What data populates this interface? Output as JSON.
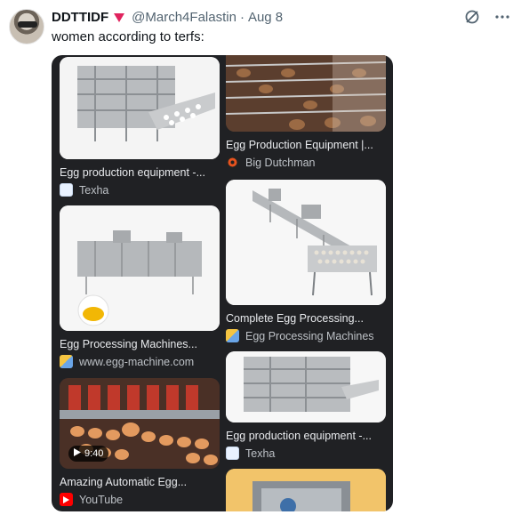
{
  "tweet": {
    "display_name": "DDTTIDF",
    "handle": "@March4Falastin",
    "date": "Aug 8",
    "text": "women according to terfs:"
  },
  "results": [
    {
      "title": "Egg production equipment -...",
      "source": "Texha"
    },
    {
      "title": "Egg Production Equipment |...",
      "source": "Big Dutchman"
    },
    {
      "title": "Egg Processing Machines...",
      "source": "www.egg-machine.com"
    },
    {
      "title": "Complete Egg Processing...",
      "source": "Egg Processing Machines"
    },
    {
      "title": "Amazing Automatic Egg...",
      "source": "YouTube",
      "duration": "9:40"
    },
    {
      "title": "Egg production equipment -...",
      "source": "Texha"
    }
  ],
  "colors": {
    "card_bg": "#202124",
    "badge_red": "#e0245e",
    "youtube_red": "#ff0000"
  },
  "icons": [
    "grok-icon",
    "more-icon",
    "heart-badge-icon",
    "play-icon"
  ]
}
